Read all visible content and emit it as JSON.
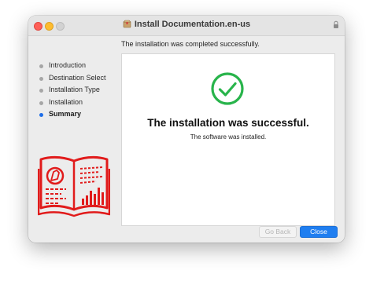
{
  "window": {
    "title": "Install Documentation.en-us"
  },
  "header": {
    "status_text": "The installation was completed successfully."
  },
  "sidebar": {
    "steps": [
      {
        "label": "Introduction"
      },
      {
        "label": "Destination Select"
      },
      {
        "label": "Installation Type"
      },
      {
        "label": "Installation"
      },
      {
        "label": "Summary"
      }
    ],
    "active_index": 4
  },
  "main": {
    "headline": "The installation was successful.",
    "subline": "The software was installed."
  },
  "buttons": {
    "back_label": "Go Back",
    "close_label": "Close"
  },
  "colors": {
    "accent": "#1f7ef0",
    "success": "#28b44b",
    "brand": "#e11b1b"
  },
  "icons": {
    "success": "checkmark-circle-icon",
    "title": "installer-package-icon",
    "lock": "lock-icon",
    "illustration": "open-book-logo-icon"
  }
}
